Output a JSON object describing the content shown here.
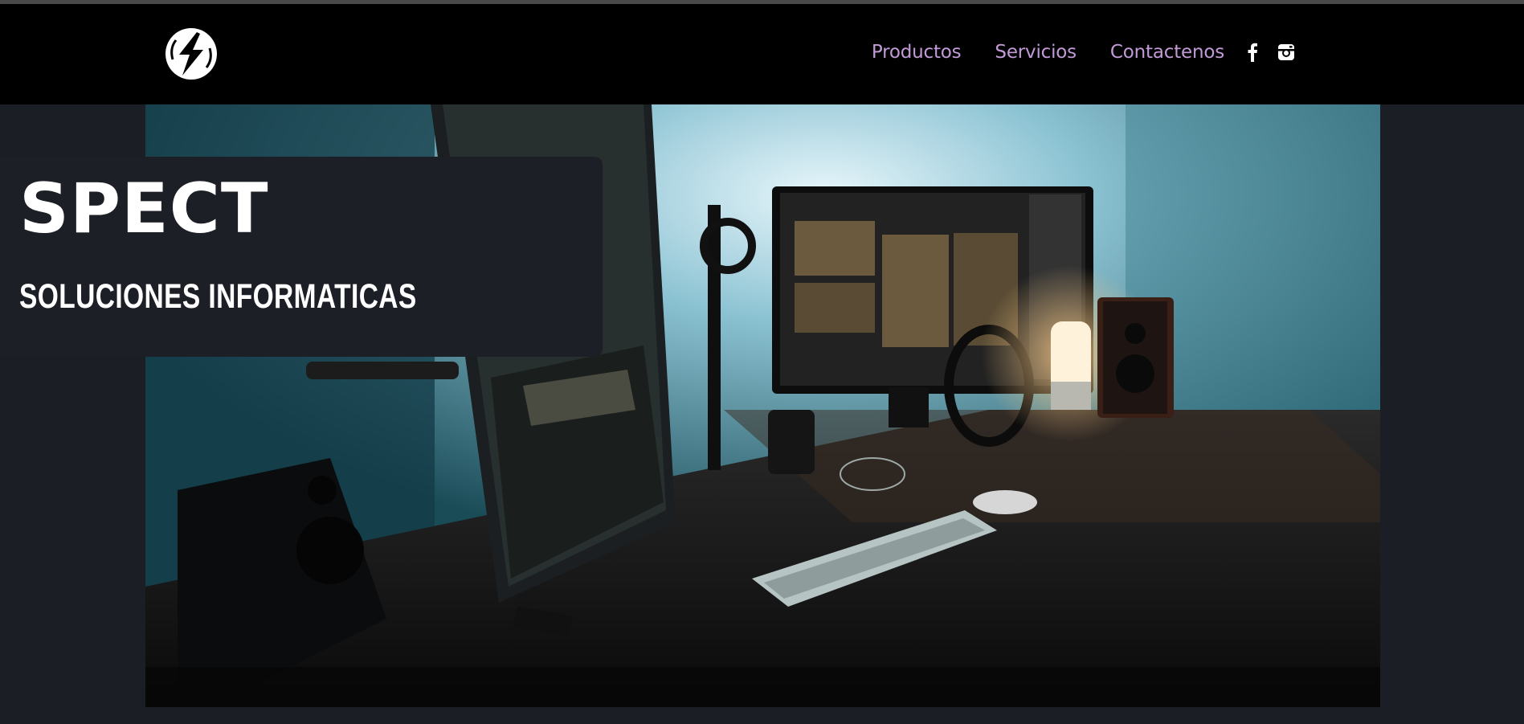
{
  "header": {
    "logo_icon": "lightning-bolt-logo-icon",
    "nav": [
      {
        "label": "Productos"
      },
      {
        "label": "Servicios"
      },
      {
        "label": "Contactenos"
      }
    ],
    "social": [
      {
        "icon": "facebook-icon"
      },
      {
        "icon": "instagram-icon"
      }
    ]
  },
  "hero": {
    "brand": "SPECT",
    "tagline": "SOLUCIONES INFORMATICAS",
    "image": "desk-setup-photo"
  },
  "colors": {
    "nav_text": "#c39ad8",
    "header_bg": "#000000",
    "page_bg": "#1c1e25",
    "card_bg": "#1d1f27"
  }
}
